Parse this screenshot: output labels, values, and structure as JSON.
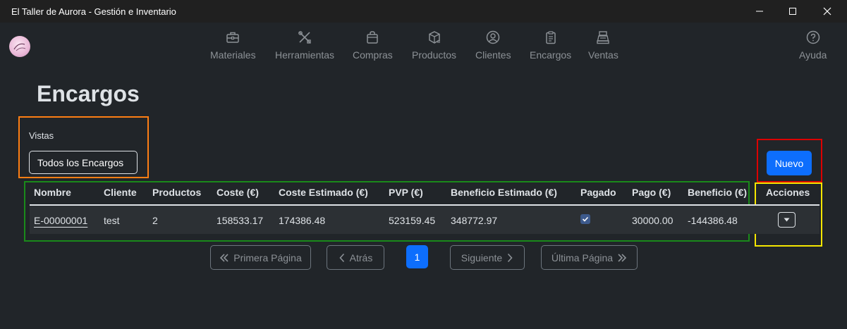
{
  "window": {
    "title": "El Taller de Aurora - Gestión e Inventario"
  },
  "nav": {
    "items": [
      {
        "label": "Materiales",
        "icon": "toolbox-icon"
      },
      {
        "label": "Herramientas",
        "icon": "tools-icon"
      },
      {
        "label": "Compras",
        "icon": "bag-icon"
      },
      {
        "label": "Productos",
        "icon": "box-icon"
      },
      {
        "label": "Clientes",
        "icon": "person-icon"
      },
      {
        "label": "Encargos",
        "icon": "clipboard-icon"
      },
      {
        "label": "Ventas",
        "icon": "cash-register-icon"
      }
    ],
    "help": {
      "label": "Ayuda",
      "icon": "question-circle-icon"
    }
  },
  "page": {
    "title": "Encargos"
  },
  "views": {
    "label": "Vistas",
    "selected": "Todos los Encargos"
  },
  "actions": {
    "new_label": "Nuevo"
  },
  "table": {
    "headers": [
      "Nombre",
      "Cliente",
      "Productos",
      "Coste (€)",
      "Coste Estimado (€)",
      "PVP (€)",
      "Beneficio Estimado (€)",
      "Pagado",
      "Pago (€)",
      "Beneficio (€)",
      "Acciones"
    ],
    "rows": [
      {
        "nombre": "E-00000001",
        "cliente": "test",
        "productos": "2",
        "coste": "158533.17",
        "coste_estimado": "174386.48",
        "pvp": "523159.45",
        "beneficio_estimado": "348772.97",
        "pagado": true,
        "pago": "30000.00",
        "beneficio": "-144386.48"
      }
    ]
  },
  "pagination": {
    "first": "Primera Página",
    "prev": "Atrás",
    "current": "1",
    "next": "Siguiente",
    "last": "Última Página"
  },
  "colors": {
    "primary": "#0d6efd",
    "background": "#212529",
    "highlight_orange": "#fd7e14",
    "highlight_red": "#dc0000",
    "highlight_green": "#1a8a1a",
    "highlight_yellow": "#f5e600"
  }
}
